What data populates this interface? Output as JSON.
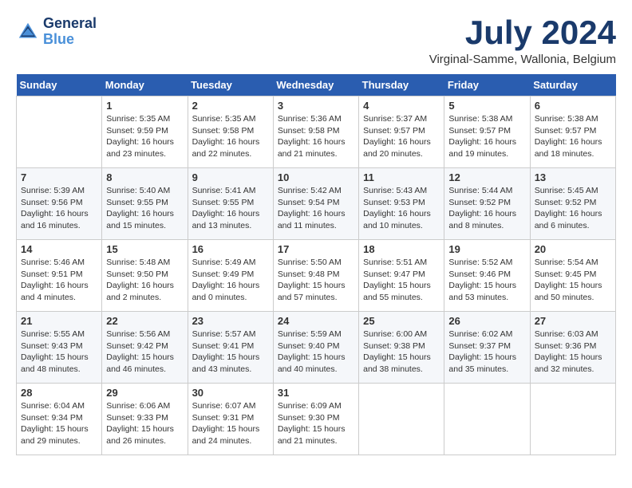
{
  "header": {
    "logo_line1": "General",
    "logo_line2": "Blue",
    "month_year": "July 2024",
    "location": "Virginal-Samme, Wallonia, Belgium"
  },
  "weekdays": [
    "Sunday",
    "Monday",
    "Tuesday",
    "Wednesday",
    "Thursday",
    "Friday",
    "Saturday"
  ],
  "weeks": [
    [
      {
        "day": "",
        "sunrise": "",
        "sunset": "",
        "daylight": ""
      },
      {
        "day": "1",
        "sunrise": "Sunrise: 5:35 AM",
        "sunset": "Sunset: 9:59 PM",
        "daylight": "Daylight: 16 hours and 23 minutes."
      },
      {
        "day": "2",
        "sunrise": "Sunrise: 5:35 AM",
        "sunset": "Sunset: 9:58 PM",
        "daylight": "Daylight: 16 hours and 22 minutes."
      },
      {
        "day": "3",
        "sunrise": "Sunrise: 5:36 AM",
        "sunset": "Sunset: 9:58 PM",
        "daylight": "Daylight: 16 hours and 21 minutes."
      },
      {
        "day": "4",
        "sunrise": "Sunrise: 5:37 AM",
        "sunset": "Sunset: 9:57 PM",
        "daylight": "Daylight: 16 hours and 20 minutes."
      },
      {
        "day": "5",
        "sunrise": "Sunrise: 5:38 AM",
        "sunset": "Sunset: 9:57 PM",
        "daylight": "Daylight: 16 hours and 19 minutes."
      },
      {
        "day": "6",
        "sunrise": "Sunrise: 5:38 AM",
        "sunset": "Sunset: 9:57 PM",
        "daylight": "Daylight: 16 hours and 18 minutes."
      }
    ],
    [
      {
        "day": "7",
        "sunrise": "Sunrise: 5:39 AM",
        "sunset": "Sunset: 9:56 PM",
        "daylight": "Daylight: 16 hours and 16 minutes."
      },
      {
        "day": "8",
        "sunrise": "Sunrise: 5:40 AM",
        "sunset": "Sunset: 9:55 PM",
        "daylight": "Daylight: 16 hours and 15 minutes."
      },
      {
        "day": "9",
        "sunrise": "Sunrise: 5:41 AM",
        "sunset": "Sunset: 9:55 PM",
        "daylight": "Daylight: 16 hours and 13 minutes."
      },
      {
        "day": "10",
        "sunrise": "Sunrise: 5:42 AM",
        "sunset": "Sunset: 9:54 PM",
        "daylight": "Daylight: 16 hours and 11 minutes."
      },
      {
        "day": "11",
        "sunrise": "Sunrise: 5:43 AM",
        "sunset": "Sunset: 9:53 PM",
        "daylight": "Daylight: 16 hours and 10 minutes."
      },
      {
        "day": "12",
        "sunrise": "Sunrise: 5:44 AM",
        "sunset": "Sunset: 9:52 PM",
        "daylight": "Daylight: 16 hours and 8 minutes."
      },
      {
        "day": "13",
        "sunrise": "Sunrise: 5:45 AM",
        "sunset": "Sunset: 9:52 PM",
        "daylight": "Daylight: 16 hours and 6 minutes."
      }
    ],
    [
      {
        "day": "14",
        "sunrise": "Sunrise: 5:46 AM",
        "sunset": "Sunset: 9:51 PM",
        "daylight": "Daylight: 16 hours and 4 minutes."
      },
      {
        "day": "15",
        "sunrise": "Sunrise: 5:48 AM",
        "sunset": "Sunset: 9:50 PM",
        "daylight": "Daylight: 16 hours and 2 minutes."
      },
      {
        "day": "16",
        "sunrise": "Sunrise: 5:49 AM",
        "sunset": "Sunset: 9:49 PM",
        "daylight": "Daylight: 16 hours and 0 minutes."
      },
      {
        "day": "17",
        "sunrise": "Sunrise: 5:50 AM",
        "sunset": "Sunset: 9:48 PM",
        "daylight": "Daylight: 15 hours and 57 minutes."
      },
      {
        "day": "18",
        "sunrise": "Sunrise: 5:51 AM",
        "sunset": "Sunset: 9:47 PM",
        "daylight": "Daylight: 15 hours and 55 minutes."
      },
      {
        "day": "19",
        "sunrise": "Sunrise: 5:52 AM",
        "sunset": "Sunset: 9:46 PM",
        "daylight": "Daylight: 15 hours and 53 minutes."
      },
      {
        "day": "20",
        "sunrise": "Sunrise: 5:54 AM",
        "sunset": "Sunset: 9:45 PM",
        "daylight": "Daylight: 15 hours and 50 minutes."
      }
    ],
    [
      {
        "day": "21",
        "sunrise": "Sunrise: 5:55 AM",
        "sunset": "Sunset: 9:43 PM",
        "daylight": "Daylight: 15 hours and 48 minutes."
      },
      {
        "day": "22",
        "sunrise": "Sunrise: 5:56 AM",
        "sunset": "Sunset: 9:42 PM",
        "daylight": "Daylight: 15 hours and 46 minutes."
      },
      {
        "day": "23",
        "sunrise": "Sunrise: 5:57 AM",
        "sunset": "Sunset: 9:41 PM",
        "daylight": "Daylight: 15 hours and 43 minutes."
      },
      {
        "day": "24",
        "sunrise": "Sunrise: 5:59 AM",
        "sunset": "Sunset: 9:40 PM",
        "daylight": "Daylight: 15 hours and 40 minutes."
      },
      {
        "day": "25",
        "sunrise": "Sunrise: 6:00 AM",
        "sunset": "Sunset: 9:38 PM",
        "daylight": "Daylight: 15 hours and 38 minutes."
      },
      {
        "day": "26",
        "sunrise": "Sunrise: 6:02 AM",
        "sunset": "Sunset: 9:37 PM",
        "daylight": "Daylight: 15 hours and 35 minutes."
      },
      {
        "day": "27",
        "sunrise": "Sunrise: 6:03 AM",
        "sunset": "Sunset: 9:36 PM",
        "daylight": "Daylight: 15 hours and 32 minutes."
      }
    ],
    [
      {
        "day": "28",
        "sunrise": "Sunrise: 6:04 AM",
        "sunset": "Sunset: 9:34 PM",
        "daylight": "Daylight: 15 hours and 29 minutes."
      },
      {
        "day": "29",
        "sunrise": "Sunrise: 6:06 AM",
        "sunset": "Sunset: 9:33 PM",
        "daylight": "Daylight: 15 hours and 26 minutes."
      },
      {
        "day": "30",
        "sunrise": "Sunrise: 6:07 AM",
        "sunset": "Sunset: 9:31 PM",
        "daylight": "Daylight: 15 hours and 24 minutes."
      },
      {
        "day": "31",
        "sunrise": "Sunrise: 6:09 AM",
        "sunset": "Sunset: 9:30 PM",
        "daylight": "Daylight: 15 hours and 21 minutes."
      },
      {
        "day": "",
        "sunrise": "",
        "sunset": "",
        "daylight": ""
      },
      {
        "day": "",
        "sunrise": "",
        "sunset": "",
        "daylight": ""
      },
      {
        "day": "",
        "sunrise": "",
        "sunset": "",
        "daylight": ""
      }
    ]
  ]
}
